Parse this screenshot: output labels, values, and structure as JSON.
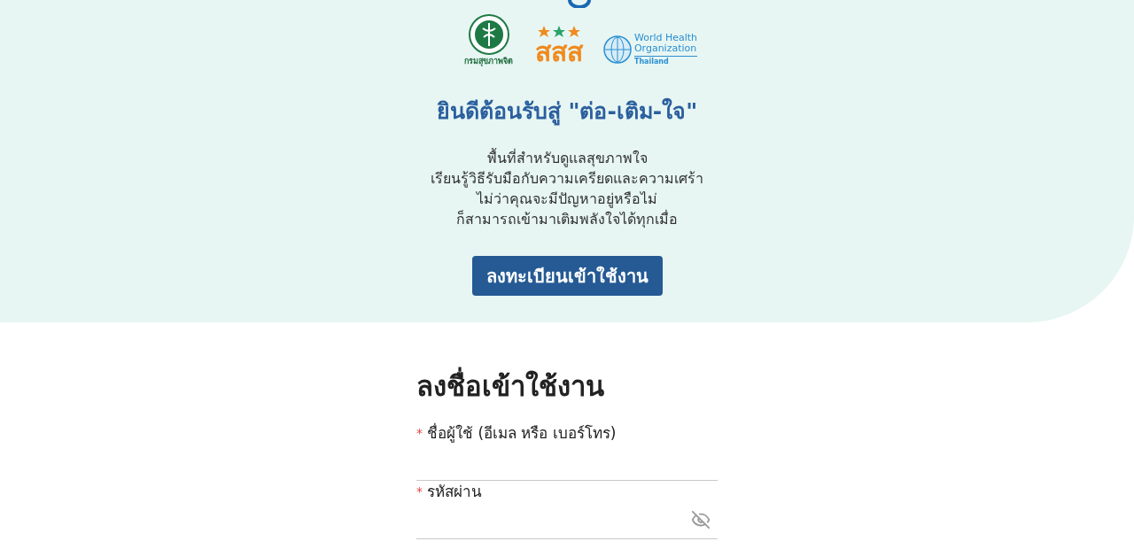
{
  "partner_logos": [
    {
      "kind": "dmh",
      "name": "กรมสุขภาพจิต"
    },
    {
      "kind": "thaihealth",
      "name": "สสส"
    },
    {
      "kind": "who",
      "name_lines": [
        "World Health",
        "Organization"
      ],
      "country": "Thailand"
    }
  ],
  "welcome": {
    "title": "ยินดีต้อนรับสู่ \"ต่อ-เติม-ใจ\"",
    "description_lines": [
      "พื้นที่สำหรับดูแลสุขภาพใจ",
      "เรียนรู้วิธีรับมือกับความเครียดและความเศร้า",
      "ไม่ว่าคุณจะมีปัญหาอยู่หรือไม่",
      "ก็สามารถเข้ามาเติมพลังใจได้ทุกเมื่อ"
    ],
    "register_button": "ลงทะเบียนเข้าใช้งาน"
  },
  "login": {
    "title": "ลงชื่อเข้าใช้งาน",
    "fields": [
      {
        "kind": "text",
        "required_mark": "*",
        "label": "ชื่อผู้ใช้ (อีเมล หรือ เบอร์โทร)"
      },
      {
        "kind": "password",
        "required_mark": "*",
        "label": "รหัสผ่าน",
        "visible": false
      }
    ]
  }
}
